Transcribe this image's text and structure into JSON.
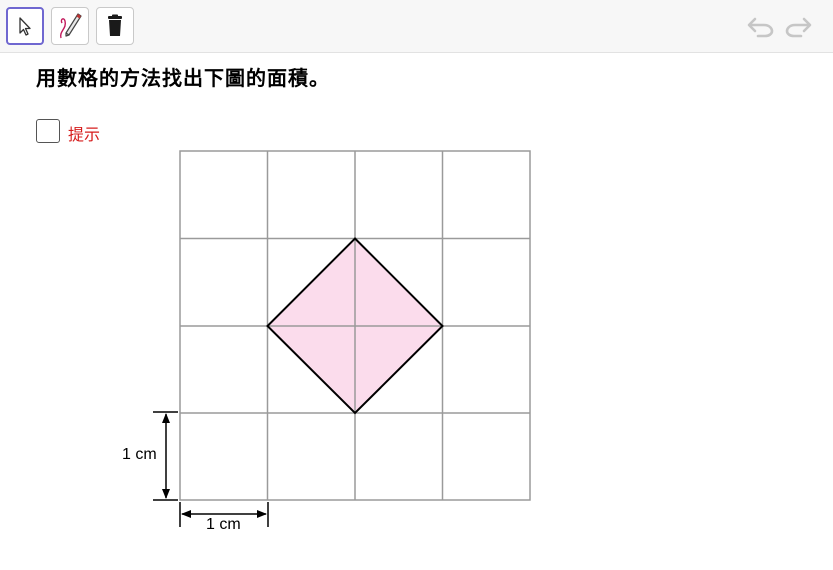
{
  "toolbar": {
    "tools": [
      {
        "name": "move",
        "icon": "cursor-arrow-icon"
      },
      {
        "name": "pen",
        "icon": "pen-icon"
      },
      {
        "name": "delete",
        "icon": "trash-icon"
      }
    ],
    "undo_icon": "undo-icon",
    "redo_icon": "redo-icon"
  },
  "question": {
    "text": "用數格的方法找出下圖的面積。"
  },
  "hint": {
    "label": "提示",
    "checked": false,
    "color": "#d61c1c"
  },
  "figure": {
    "grid_cols": 4,
    "grid_rows": 4,
    "shape": "diamond",
    "fill_color": "#fbdcec",
    "grid_color": "#9a9a9a",
    "outline_color": "#000000",
    "vertical_dim_label": "1 cm",
    "horizontal_dim_label": "1 cm"
  },
  "colors": {
    "active_tool_border": "#6f67d0",
    "toolbar_bg": "#f7f7f7"
  }
}
